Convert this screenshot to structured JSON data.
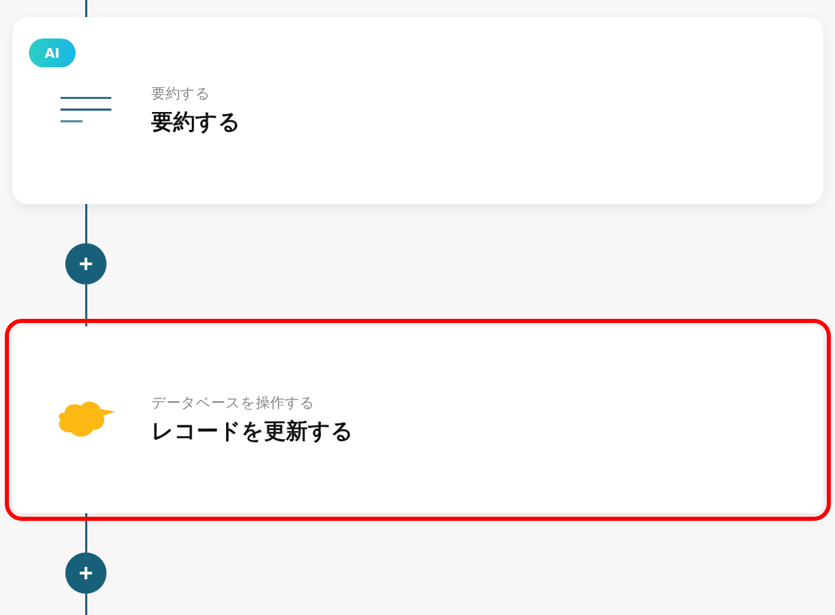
{
  "flow": [
    {
      "kind": "step",
      "badge": "AI",
      "category": "要約する",
      "title": "要約する",
      "highlighted": false
    },
    {
      "kind": "add"
    },
    {
      "kind": "step",
      "category": "データベースを操作する",
      "title": "レコードを更新する",
      "highlighted": true
    },
    {
      "kind": "add"
    }
  ]
}
